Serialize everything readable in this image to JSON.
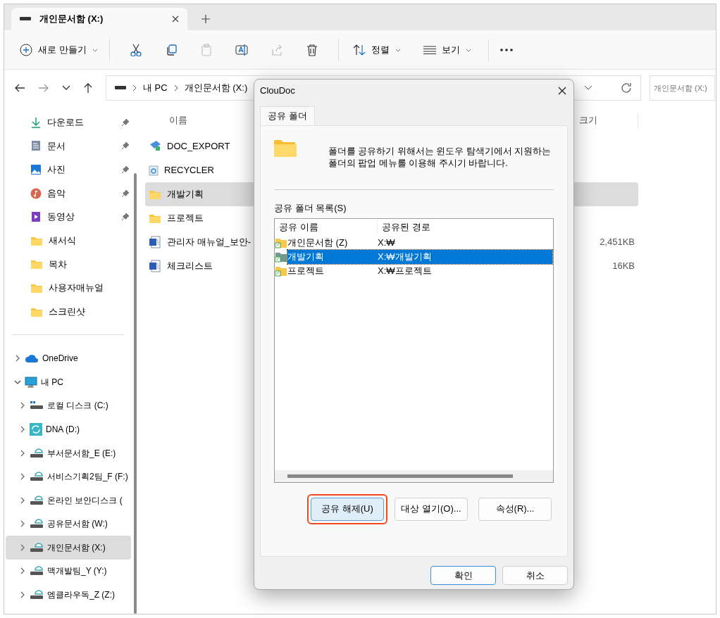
{
  "window": {
    "tabs": [
      {
        "label": "개인문서함 (X:)",
        "selected": true
      }
    ]
  },
  "toolbar": {
    "new_label": "새로 만들기",
    "sort_label": "정렬",
    "view_label": "보기"
  },
  "address": {
    "crumbs": [
      "내 PC",
      "개인문서함 (X:)"
    ],
    "search_placeholder": "개인문서함 (X:)"
  },
  "sidebar": {
    "quick": [
      {
        "label": "다운로드",
        "kind": "download",
        "pinned": true
      },
      {
        "label": "문서",
        "kind": "document",
        "pinned": true
      },
      {
        "label": "사진",
        "kind": "picture",
        "pinned": true
      },
      {
        "label": "음악",
        "kind": "music",
        "pinned": true
      },
      {
        "label": "동영상",
        "kind": "video",
        "pinned": true
      },
      {
        "label": "새서식",
        "kind": "folder",
        "pinned": false
      },
      {
        "label": "목차",
        "kind": "folder",
        "pinned": false
      },
      {
        "label": "사용자매뉴얼",
        "kind": "folder",
        "pinned": false
      },
      {
        "label": "스크린샷",
        "kind": "folder",
        "pinned": false
      }
    ],
    "tree": [
      {
        "label": "OneDrive",
        "kind": "cloud",
        "expanded": false,
        "selected": false
      },
      {
        "label": "내 PC",
        "kind": "pc",
        "expanded": true,
        "selected": false,
        "children": [
          {
            "label": "로컬 디스크 (C:)",
            "kind": "disk",
            "expanded": false,
            "selected": false
          },
          {
            "label": "DNA (D:)",
            "kind": "sync",
            "expanded": false,
            "selected": false
          },
          {
            "label": "부서문서함_E (E:)",
            "kind": "netdisk",
            "expanded": false,
            "selected": false
          },
          {
            "label": "서비스기획2팀_F (F:)",
            "kind": "netdisk",
            "expanded": false,
            "selected": false
          },
          {
            "label": "온라인 보안디스크 (",
            "kind": "netdisk",
            "expanded": false,
            "selected": false
          },
          {
            "label": "공유문서함 (W:)",
            "kind": "netdisk",
            "expanded": false,
            "selected": false
          },
          {
            "label": "개인문서함 (X:)",
            "kind": "netdisk",
            "expanded": false,
            "selected": true
          },
          {
            "label": "맥개발팀_Y (Y:)",
            "kind": "netdisk",
            "expanded": false,
            "selected": false
          },
          {
            "label": "엠클라우독_Z (Z:)",
            "kind": "netdisk",
            "expanded": false,
            "selected": false
          }
        ]
      }
    ]
  },
  "file_list": {
    "columns": [
      "이름",
      "크기"
    ],
    "rows": [
      {
        "name": "DOC_EXPORT",
        "kind": "app",
        "size": "",
        "selected": false
      },
      {
        "name": "RECYCLER",
        "kind": "recycle",
        "size": "",
        "selected": false
      },
      {
        "name": "개발기획",
        "kind": "folder",
        "size": "",
        "selected": true
      },
      {
        "name": "프로젝트",
        "kind": "folder",
        "size": "",
        "selected": false
      },
      {
        "name": "관리자 매뉴얼_보안-",
        "kind": "word",
        "size": "2,451KB",
        "selected": false
      },
      {
        "name": "체크리스트",
        "kind": "word",
        "size": "16KB",
        "selected": false
      }
    ]
  },
  "dialog": {
    "title": "ClouDoc",
    "tab": {
      "label": "공유 폴더",
      "selected": true
    },
    "message": "폴더를 공유하기 위해서는 윈도우 탐색기에서 지원하는 폴더의 팝업 메뉴를 이용해 주시기 바랍니다.",
    "list_label": "공유 폴더 목록(S)",
    "columns": [
      "공유 이름",
      "공유된 경로"
    ],
    "rows": [
      {
        "name": "개인문서함 (Z)",
        "path": "X:₩",
        "selected": false
      },
      {
        "name": "개발기획",
        "path": "X:₩개발기획",
        "selected": true
      },
      {
        "name": "프로젝트",
        "path": "X:₩프로젝트",
        "selected": false
      }
    ],
    "actions": [
      {
        "label": "공유 해제(U)",
        "highlighted": true
      },
      {
        "label": "대상 열기(O)...",
        "highlighted": false
      },
      {
        "label": "속성(R)...",
        "highlighted": false
      }
    ],
    "footer": [
      {
        "label": "확인",
        "default": true
      },
      {
        "label": "취소",
        "default": false
      }
    ]
  }
}
